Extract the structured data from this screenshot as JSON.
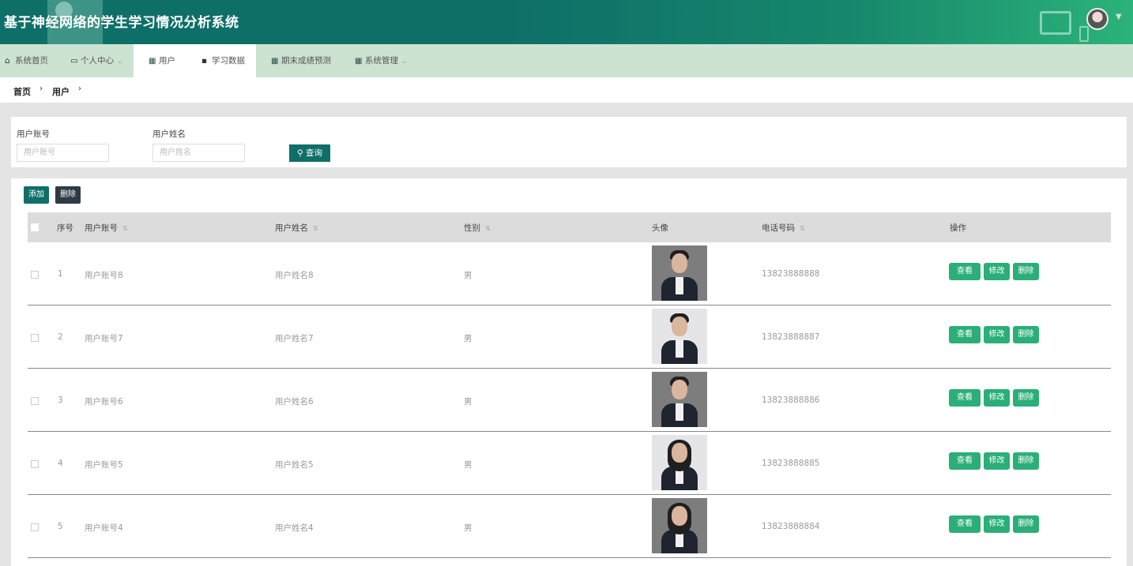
{
  "header": {
    "title": "基于神经网络的学生学习情况分析系统"
  },
  "nav": {
    "items": [
      {
        "label": "系统首页",
        "icon": "home-icon"
      },
      {
        "label": "个人中心",
        "icon": "id-card-icon"
      },
      {
        "label": "用户",
        "icon": "grid-icon"
      },
      {
        "label": "学习数据",
        "icon": "comment-icon"
      },
      {
        "label": "期末成绩预测",
        "icon": "grid-icon"
      },
      {
        "label": "系统管理",
        "icon": "grid-icon"
      }
    ]
  },
  "breadcrumb": {
    "home": "首页",
    "current": "用户"
  },
  "search": {
    "account_label": "用户账号",
    "account_placeholder": "用户账号",
    "name_label": "用户姓名",
    "name_placeholder": "用户姓名",
    "query_label": "查询"
  },
  "toolbar": {
    "add_label": "添加",
    "delete_label": "删除"
  },
  "table": {
    "headers": {
      "index": "序号",
      "account": "用户账号",
      "name": "用户姓名",
      "gender": "性别",
      "avatar": "头像",
      "phone": "电话号码",
      "actions": "操作"
    },
    "rows": [
      {
        "index": "1",
        "account": "用户账号8",
        "name": "用户姓名8",
        "gender": "男",
        "phone": "13823888888"
      },
      {
        "index": "2",
        "account": "用户账号7",
        "name": "用户姓名7",
        "gender": "男",
        "phone": "13823888887"
      },
      {
        "index": "3",
        "account": "用户账号6",
        "name": "用户姓名6",
        "gender": "男",
        "phone": "13823888886"
      },
      {
        "index": "4",
        "account": "用户账号5",
        "name": "用户姓名5",
        "gender": "男",
        "phone": "13823888885"
      },
      {
        "index": "5",
        "account": "用户账号4",
        "name": "用户姓名4",
        "gender": "男",
        "phone": "13823888884"
      }
    ],
    "actions": {
      "view": "查看",
      "edit": "修改",
      "remove": "删除"
    }
  },
  "colors": {
    "primary": "#0e6f68",
    "action": "#2bae78",
    "nav_bg": "#cde3d2"
  }
}
